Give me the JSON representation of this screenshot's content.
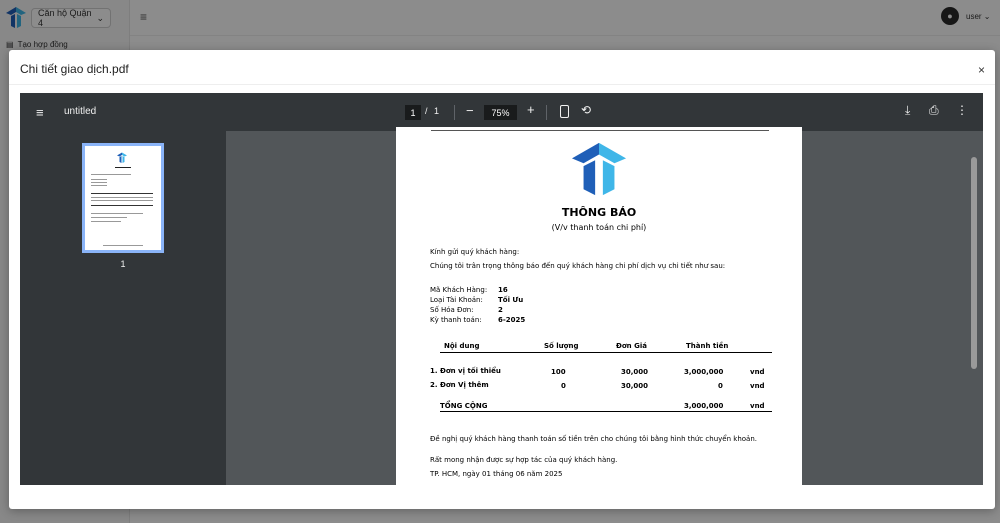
{
  "app": {
    "branch_select": "Căn hộ Quận 4",
    "sidebar_item": "Tạo hợp đồng",
    "user_name": "user"
  },
  "modal": {
    "title": "Chi tiết giao dịch.pdf",
    "close": "×"
  },
  "viewer": {
    "doc_title": "untitled",
    "current_page": "1",
    "page_sep": "/",
    "total_pages": "1",
    "zoom": "75%",
    "thumb_page": "1"
  },
  "document": {
    "heading": "THÔNG BÁO",
    "subheading": "(V/v thanh toán chi phí)",
    "greeting": "Kính gửi quý khách hàng:",
    "intro": "Chúng tôi trân trọng thông báo đến quý khách hàng chi phí dịch vụ chi tiết như sau:",
    "info": [
      {
        "label": "Mã Khách Hàng:",
        "value": "16"
      },
      {
        "label": "Loại Tài Khoản:",
        "value": "Tối Ưu"
      },
      {
        "label": "Số Hóa Đơn:",
        "value": "2"
      },
      {
        "label": "Kỳ thanh toán:",
        "value": "6-2025"
      }
    ],
    "table": {
      "headers": [
        "Nội dung",
        "Số lượng",
        "Đơn Giá",
        "Thành tiền"
      ],
      "rows": [
        {
          "name": "1. Đơn vị tối thiểu",
          "qty": "100",
          "price": "30,000",
          "total": "3,000,000",
          "unit": "vnd"
        },
        {
          "name": "2. Đơn Vị thêm",
          "qty": "0",
          "price": "30,000",
          "total": "0",
          "unit": "vnd"
        }
      ],
      "sum_label": "TỔNG CỘNG",
      "sum_total": "3,000,000",
      "sum_unit": "vnd"
    },
    "request": "Đề nghị quý khách hàng thanh toán số tiền trên cho chúng tôi bằng hình thức chuyển khoản.",
    "thanks": "Rất mong nhận được sự hợp tác của quý khách hàng.",
    "place_date": "TP. HCM, ngày 01 tháng 06 năm 2025"
  },
  "colors": {
    "logo_dark": "#1f5fb8",
    "logo_light": "#3fb6e8",
    "toolbar": "#323639",
    "viewer_bg": "#525659",
    "thumb_border": "#8ab4f8"
  }
}
